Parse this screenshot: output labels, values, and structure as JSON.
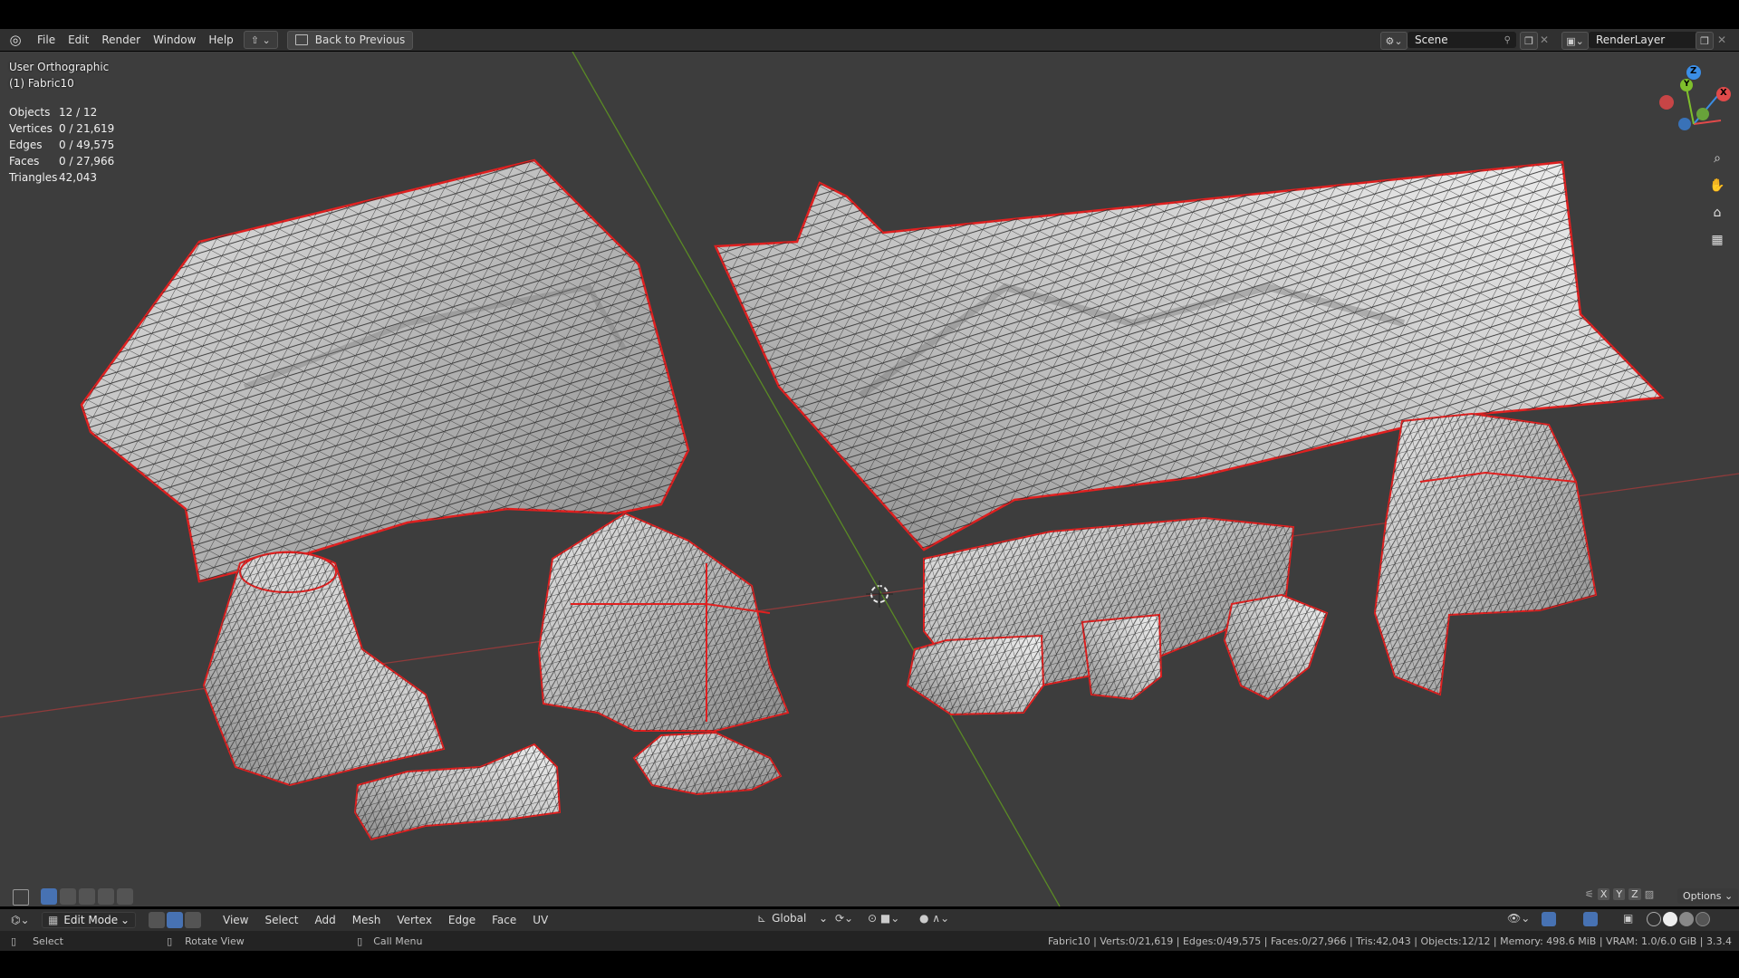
{
  "menu": {
    "logo": "blender-logo",
    "items": [
      "File",
      "Edit",
      "Render",
      "Window",
      "Help"
    ],
    "back_label": "Back to Previous"
  },
  "scene": {
    "name": "Scene",
    "layer": "RenderLayer"
  },
  "viewport": {
    "view_name": "User Orthographic",
    "object_name": "(1) Fabric10",
    "stats": [
      {
        "k": "Objects",
        "v": "12 / 12"
      },
      {
        "k": "Vertices",
        "v": "0 / 21,619"
      },
      {
        "k": "Edges",
        "v": "0 / 49,575"
      },
      {
        "k": "Faces",
        "v": "0 / 27,966"
      },
      {
        "k": "Triangles",
        "v": "42,043"
      }
    ],
    "gizmo": {
      "x": "X",
      "y": "Y",
      "z": "Z"
    }
  },
  "header": {
    "mode": "Edit Mode",
    "menus": [
      "View",
      "Select",
      "Add",
      "Mesh",
      "Vertex",
      "Edge",
      "Face",
      "UV"
    ],
    "orientation": "Global",
    "axes": [
      "X",
      "Y",
      "Z"
    ],
    "options": "Options"
  },
  "status": {
    "select": "Select",
    "rotate": "Rotate View",
    "call_menu": "Call Menu",
    "info": "Fabric10 | Verts:0/21,619 | Edges:0/49,575 | Faces:0/27,966 | Tris:42,043 | Objects:12/12 | Memory: 498.6 MiB | VRAM: 1.0/6.0 GiB | 3.3.4"
  },
  "colors": {
    "accent": "#4772b3",
    "edge_seam": "#e02020",
    "axis_x": "#b8403f",
    "axis_y": "#6a9a2c"
  }
}
